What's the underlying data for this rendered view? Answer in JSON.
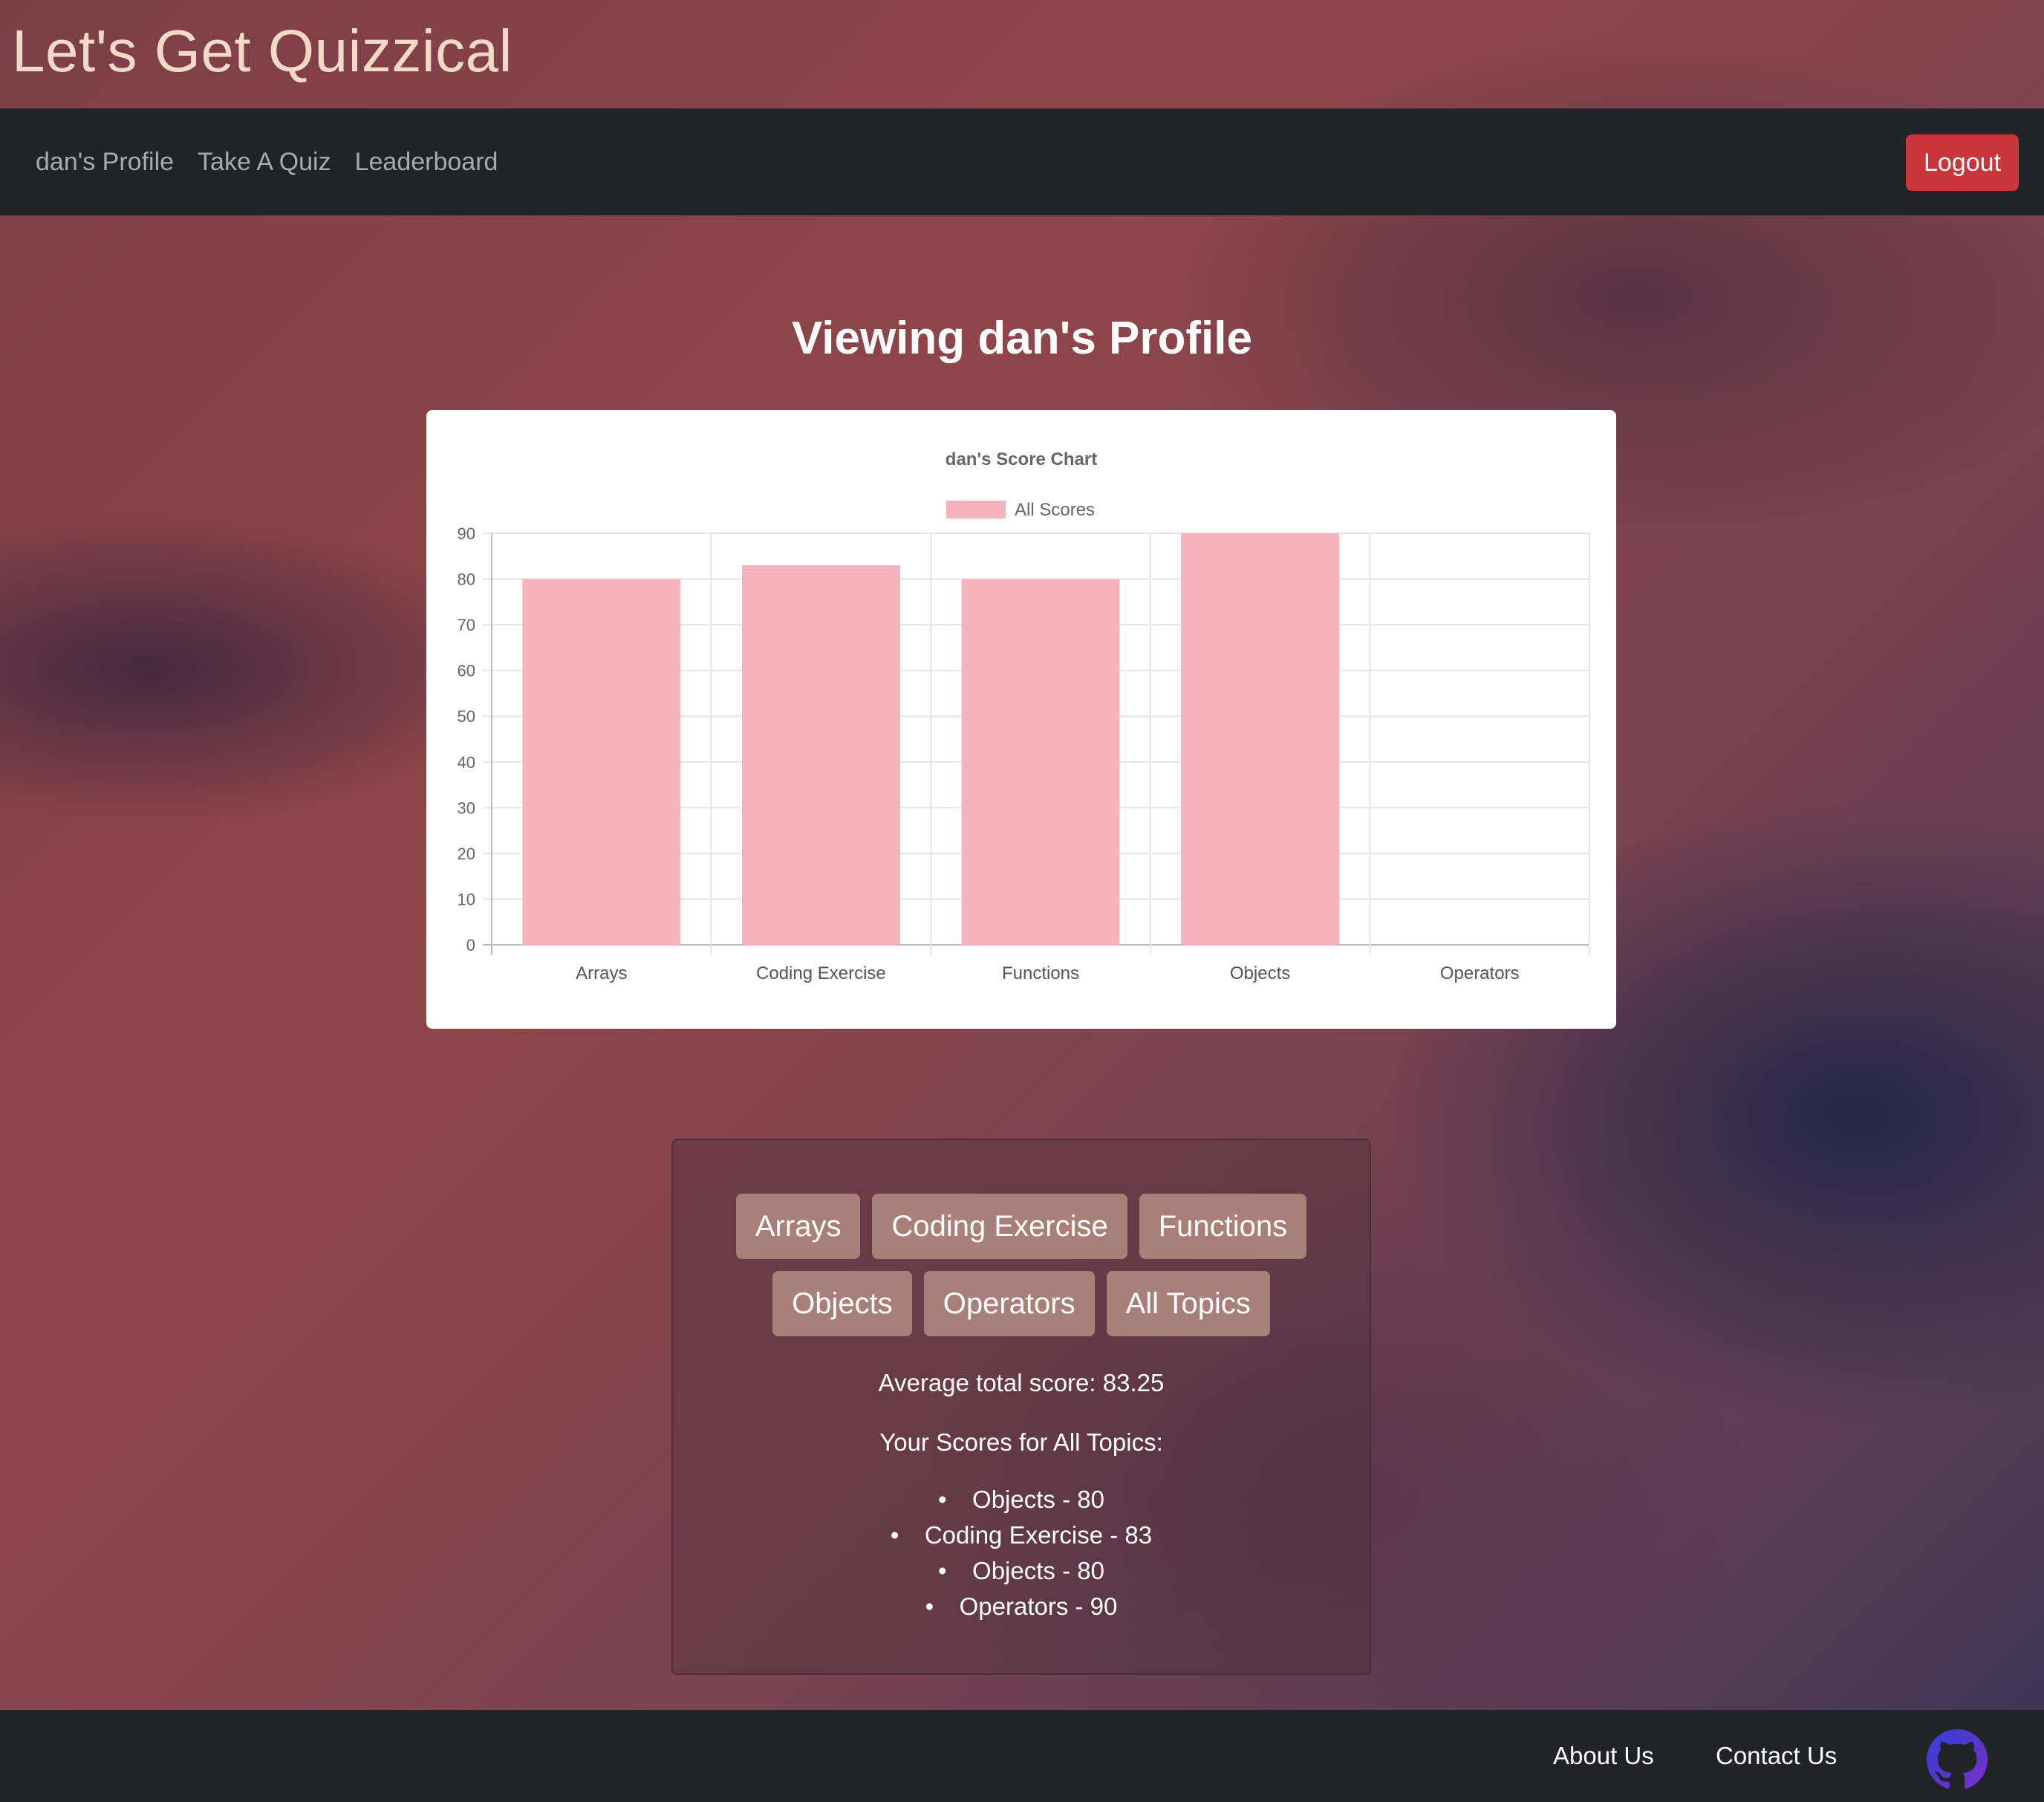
{
  "app": {
    "title": "Let's Get Quizzical"
  },
  "nav": {
    "items": [
      {
        "label": "dan's Profile"
      },
      {
        "label": "Take A Quiz"
      },
      {
        "label": "Leaderboard"
      }
    ],
    "logout_label": "Logout"
  },
  "page": {
    "heading": "Viewing dan's Profile"
  },
  "colors": {
    "bar": "#f4b3bd",
    "logout": "#c8353a",
    "topic_button": "#a98079",
    "navbar": "#212327"
  },
  "chart_data": {
    "type": "bar",
    "title": "dan's Score Chart",
    "categories": [
      "Arrays",
      "Coding Exercise",
      "Functions",
      "Objects",
      "Operators"
    ],
    "series": [
      {
        "name": "All Scores",
        "values": [
          80,
          83,
          80,
          90,
          0
        ]
      }
    ],
    "yticks": [
      "0",
      "10",
      "20",
      "30",
      "40",
      "50",
      "60",
      "70",
      "80",
      "90"
    ],
    "ylim": [
      0,
      90
    ],
    "legend": "top",
    "grid": true
  },
  "topics": {
    "row1": [
      "Arrays",
      "Coding Exercise",
      "Functions"
    ],
    "row2": [
      "Objects",
      "Operators",
      "All Topics"
    ]
  },
  "stats": {
    "average_text": "Average total score: 83.25",
    "list_title": "Your Scores for All Topics:",
    "scores": [
      "Objects - 80",
      "Coding Exercise - 83",
      "Objects - 80",
      "Operators - 90"
    ]
  },
  "footer": {
    "about_label": "About Us",
    "contact_label": "Contact Us",
    "github_icon": "github-icon"
  }
}
